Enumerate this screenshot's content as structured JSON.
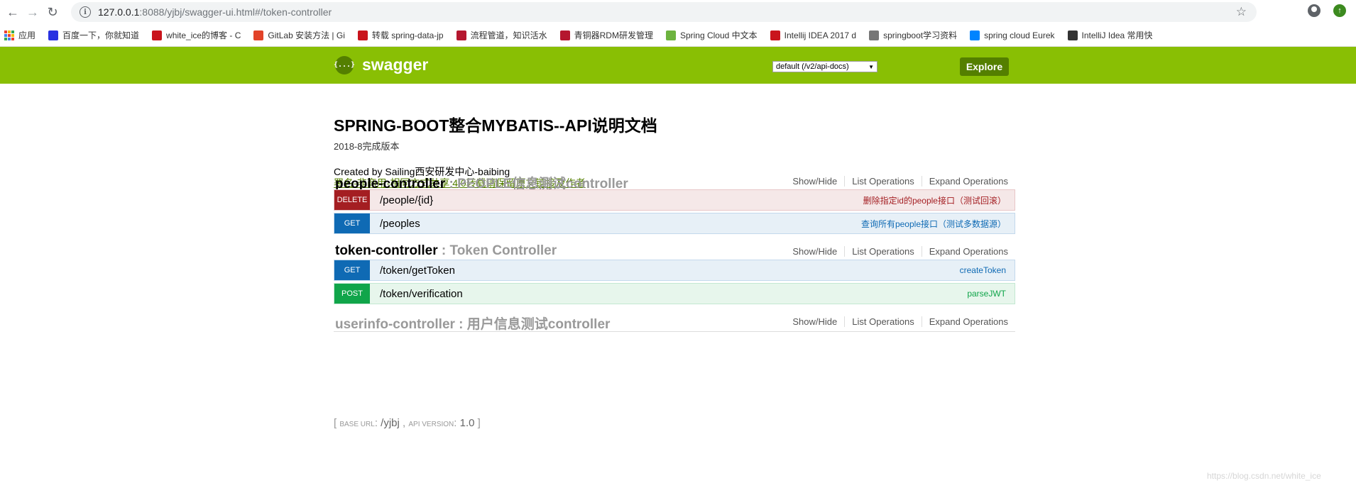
{
  "browser": {
    "url_host": "127.0.0.1",
    "url_path": ":8088/yjbj/swagger-ui.html#/token-controller",
    "bookmarks": [
      {
        "label": "应用",
        "icon": "apps-grid-icon",
        "color": "#4285f4"
      },
      {
        "label": "百度一下，你就知道",
        "icon": "baidu-icon",
        "color": "#2932e1"
      },
      {
        "label": "white_ice的博客 - C",
        "icon": "csdn-icon",
        "color": "#c9141c"
      },
      {
        "label": "GitLab 安装方法 | Gi",
        "icon": "gitlab-icon",
        "color": "#e24329"
      },
      {
        "label": "转载 spring-data-jp",
        "icon": "csdn-icon",
        "color": "#c9141c"
      },
      {
        "label": "流程管道，知识活水",
        "icon": "flow-icon",
        "color": "#b5172f"
      },
      {
        "label": "青铜器RDM研发管理",
        "icon": "rdm-icon",
        "color": "#b5172f"
      },
      {
        "label": "Spring Cloud 中文本",
        "icon": "spring-icon",
        "color": "#6db33f"
      },
      {
        "label": "Intellij IDEA 2017 d",
        "icon": "csdn-icon",
        "color": "#c9141c"
      },
      {
        "label": "springboot学习资料",
        "icon": "doc-icon",
        "color": "#777777"
      },
      {
        "label": "spring cloud Eurek",
        "icon": "zhihu-icon",
        "color": "#0084ff"
      },
      {
        "label": "IntelliJ Idea 常用快",
        "icon": "idea-icon",
        "color": "#333333"
      }
    ]
  },
  "swagger": {
    "logo_text": "swagger",
    "logo_mark": "{...}",
    "spec_select": "default (/v2/api-docs)",
    "explore_label": "Explore"
  },
  "info": {
    "title": "SPRING-BOOT整合MYBATIS--API说明文档",
    "version": "2018-8完成版本",
    "created_by": "Created by Sailing西安研发中心-baibing",
    "license": "署名-非商用-相同方式共享 4.0转载请保留原文链接及作者"
  },
  "controller_links": {
    "show_hide": "Show/Hide",
    "list": "List Operations",
    "expand": "Expand Operations"
  },
  "resources": [
    {
      "name": "people-controller",
      "description": " : PEOPLE信息测试controller",
      "operations": [
        {
          "method": "DELETE",
          "path": "/people/{id}",
          "summary": "删除指定id的people接口（测试回滚）"
        },
        {
          "method": "GET",
          "path": "/peoples",
          "summary": "查询所有people接口（测试多数据源）"
        }
      ]
    },
    {
      "name": "token-controller",
      "description": " : Token Controller",
      "operations": [
        {
          "method": "GET",
          "path": "/token/getToken",
          "summary": "createToken"
        },
        {
          "method": "POST",
          "path": "/token/verification",
          "summary": "parseJWT"
        }
      ]
    },
    {
      "name": "userinfo-controller",
      "description": " : 用户信息测试controller",
      "operations": []
    }
  ],
  "footer": {
    "open": "[ ",
    "base_url_label": "Base URL",
    "base_url": "/yjbj",
    "api_version_label": "API Version",
    "api_version": "1.0",
    "close": " ]"
  },
  "watermark": "https://blog.csdn.net/white_ice"
}
